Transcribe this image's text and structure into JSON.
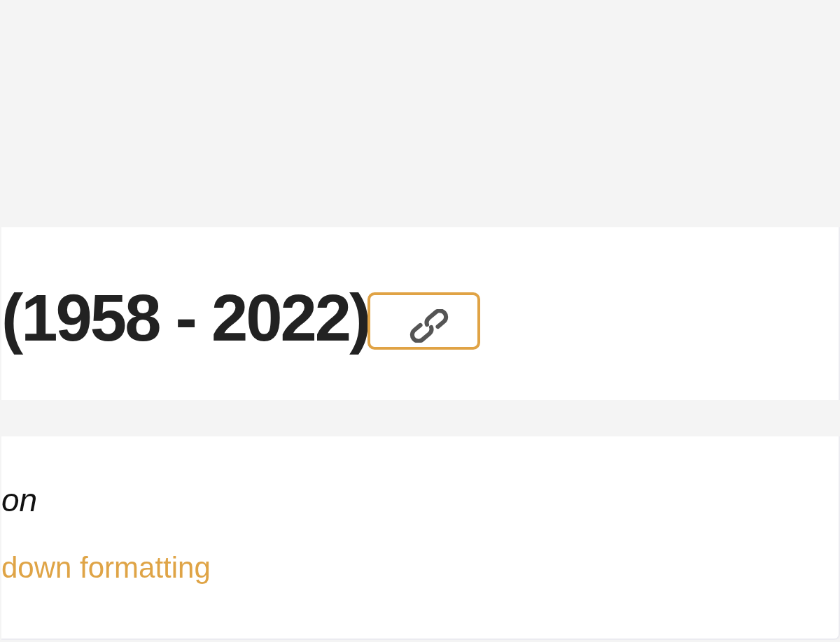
{
  "heading": {
    "text": "(1958 - 2022)",
    "permalink": {
      "focused": true
    }
  },
  "body": {
    "paragraphs": [
      {
        "kind": "italic",
        "text": "on"
      },
      {
        "kind": "link",
        "text": "down formatting"
      }
    ]
  }
}
